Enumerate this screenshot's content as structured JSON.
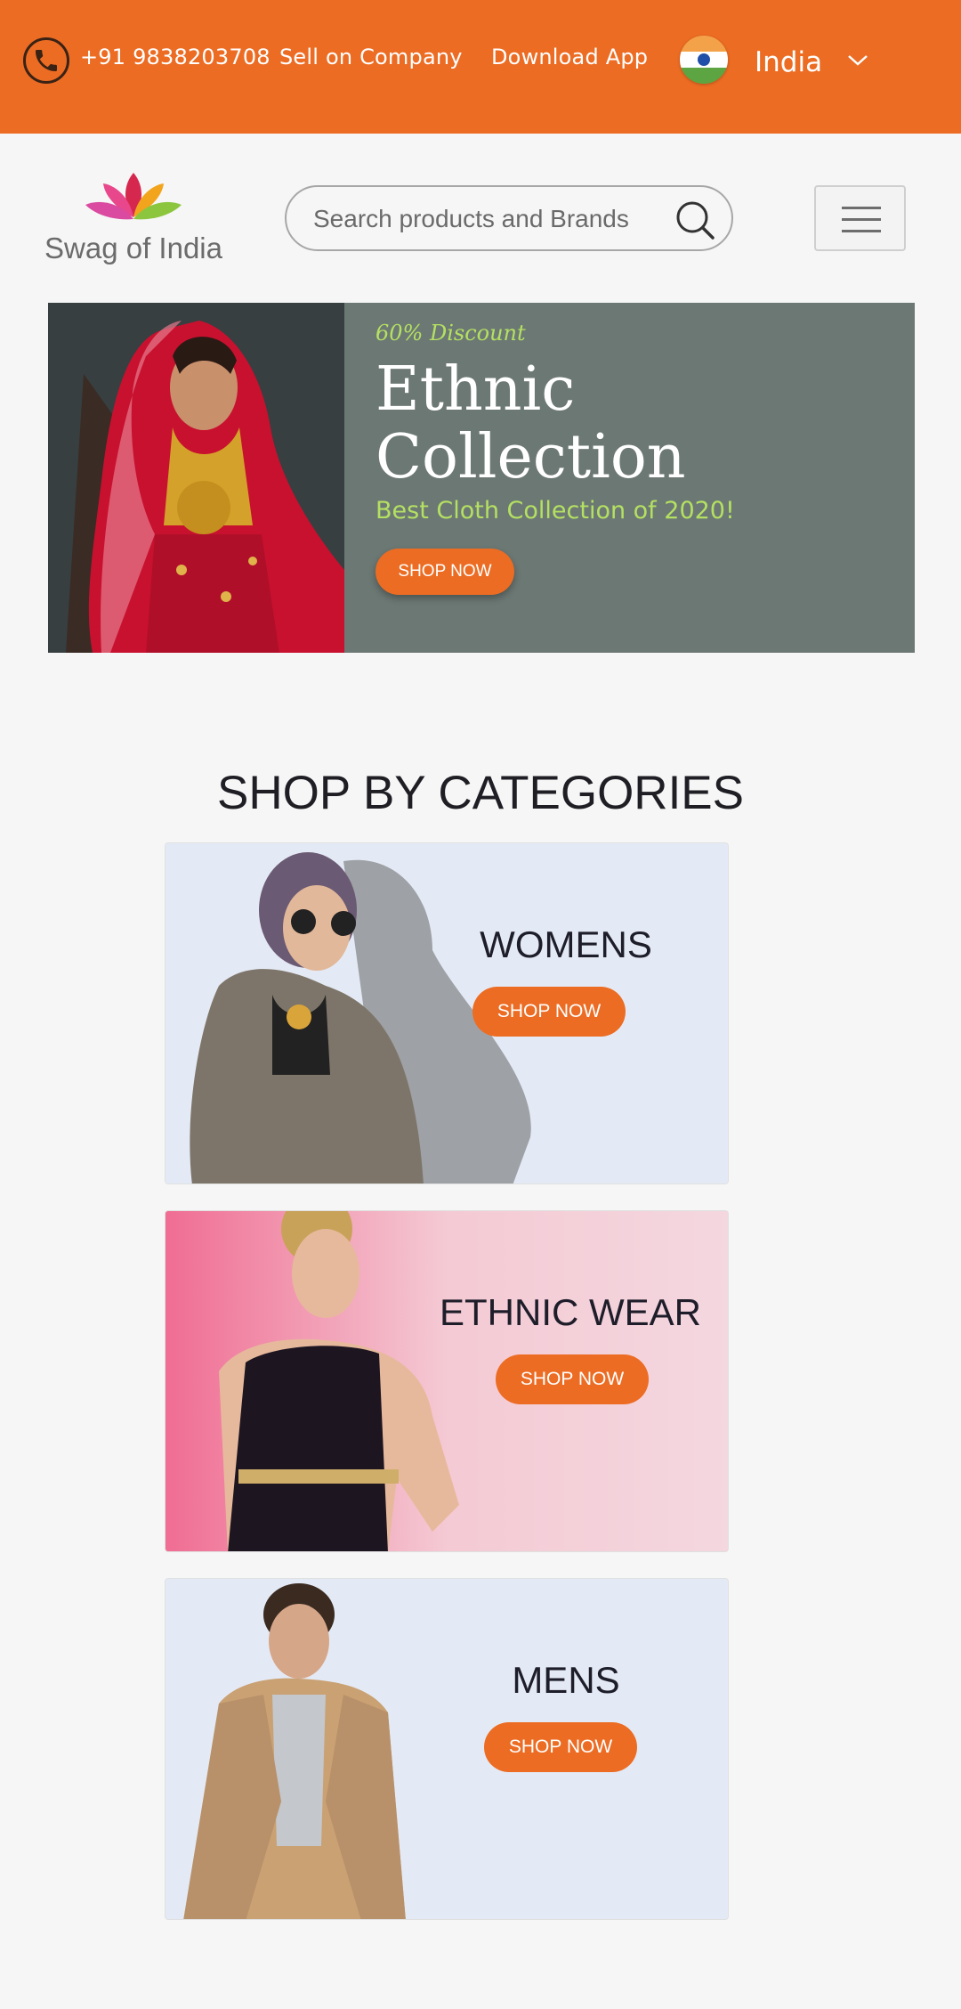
{
  "topbar": {
    "phone": "+91 9838203708",
    "sell": "Sell on Company",
    "download": "Download App",
    "country": "India",
    "icons": {
      "phone": "phone-icon",
      "flag": "india-flag-icon",
      "dropdown": "chevron-down-icon"
    }
  },
  "header": {
    "logo_text": "Swag of India",
    "search_placeholder": "Search products and Brands"
  },
  "hero": {
    "discount": "60% Discount",
    "title": "Ethnic Collection",
    "subtitle": "Best Cloth Collection of 2020!",
    "button": "SHOP NOW"
  },
  "categories": {
    "title": "SHOP BY CATEGORIES",
    "items": [
      {
        "label": "WOMENS",
        "button": "SHOP NOW"
      },
      {
        "label": "ETHNIC WEAR",
        "button": "SHOP NOW"
      },
      {
        "label": "MENS",
        "button": "SHOP NOW"
      }
    ]
  },
  "colors": {
    "accent": "#ec6c23",
    "hero_bg": "#6c7874",
    "hero_text_accent": "#b4e062",
    "page_bg": "#f6f6f6"
  }
}
